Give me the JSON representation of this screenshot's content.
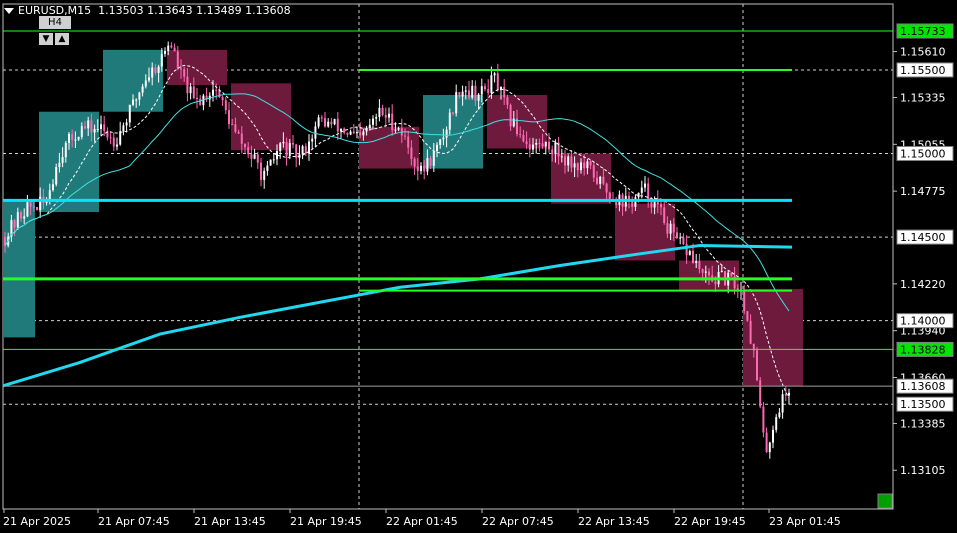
{
  "header": {
    "symbol": "EURUSD,M15",
    "ohlc": "1.13503 1.13643 1.13489 1.13608"
  },
  "timeframe": {
    "label": "H4",
    "down": "▼",
    "up": "▲"
  },
  "colors": {
    "bull_zone": "#217a7a",
    "bear_zone": "#6e1a3c",
    "candle_bull": "#ffffff",
    "candle_bear": "#ff69b4",
    "fast_ma": "#ffffff",
    "mid_ma": "#40e0e0",
    "slow_ma": "#20d8f0",
    "support_line": "#22ff22",
    "cyan_level": "#00e5ff",
    "badge_green": "#00e600",
    "grid": "#d0d0d0"
  },
  "price_axis": {
    "ticks": [
      "1.15610",
      "1.15335",
      "1.15055",
      "1.14775",
      "1.14220",
      "1.13940",
      "1.13660",
      "1.13385",
      "1.13105"
    ],
    "badges": [
      {
        "text": "1.15733",
        "style": "green"
      },
      {
        "text": "1.15500",
        "style": "white"
      },
      {
        "text": "1.15000",
        "style": "white"
      },
      {
        "text": "1.14500",
        "style": "white"
      },
      {
        "text": "1.14000",
        "style": "white"
      },
      {
        "text": "1.13828",
        "style": "green"
      },
      {
        "text": "1.13608",
        "style": "white"
      },
      {
        "text": "1.13500",
        "style": "white"
      }
    ]
  },
  "time_axis": {
    "labels": [
      "21 Apr 2025",
      "21 Apr 07:45",
      "21 Apr 13:45",
      "21 Apr 19:45",
      "22 Apr 01:45",
      "22 Apr 07:45",
      "22 Apr 13:45",
      "22 Apr 19:45",
      "23 Apr 01:45"
    ]
  },
  "levels": {
    "green_top": "1.15733",
    "green_long": "1.15500",
    "cyan_horizontal": "1.1472",
    "green_thick": "1.1425",
    "green_mid": "1.1418",
    "green_bottom": "1.13828",
    "current_price": "1.13608"
  }
}
